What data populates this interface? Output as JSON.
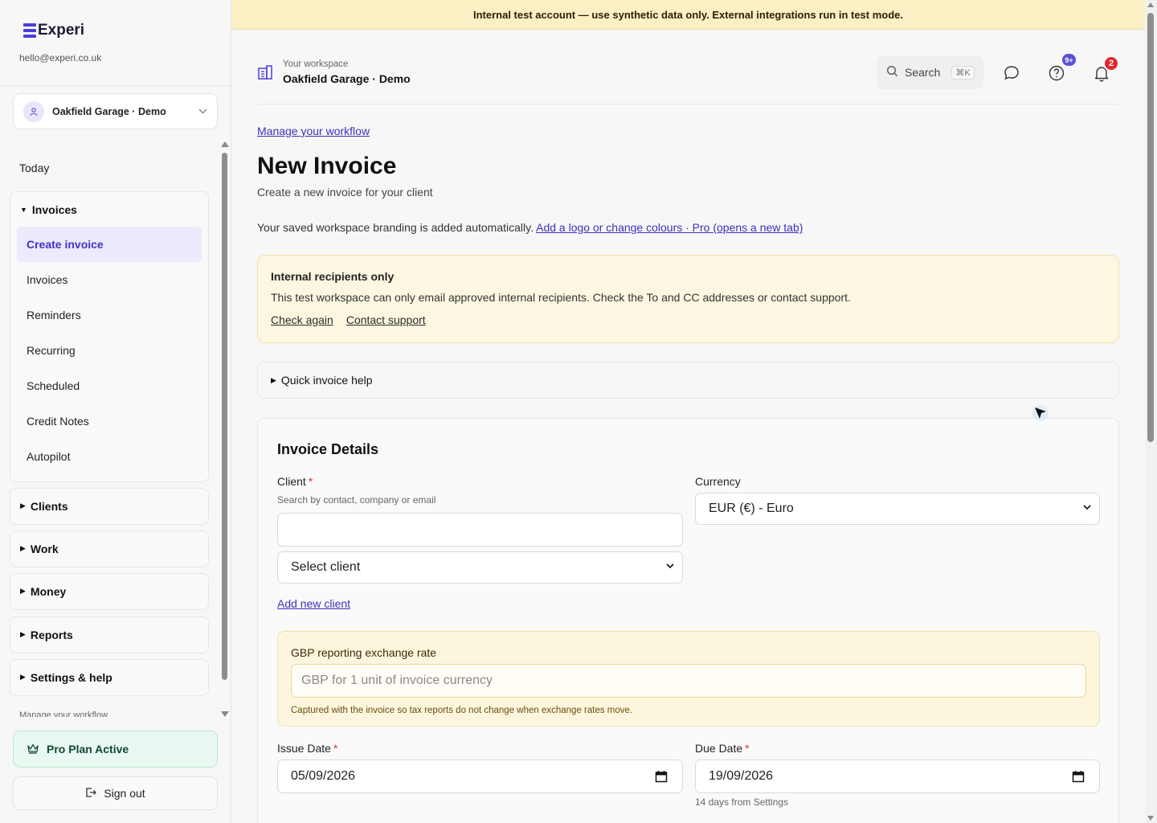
{
  "brand": {
    "name": "Experi",
    "email": "hello@experi.co.uk",
    "accent": "#4b3fd9"
  },
  "workspace_selector": {
    "name": "Oakfield Garage · Demo"
  },
  "sidebar": {
    "today": "Today",
    "groups": [
      {
        "label": "Invoices",
        "expanded": true,
        "items": [
          "Create invoice",
          "Invoices",
          "Reminders",
          "Recurring",
          "Scheduled",
          "Credit Notes",
          "Autopilot"
        ],
        "active": "Create invoice"
      },
      {
        "label": "Clients",
        "expanded": false
      },
      {
        "label": "Work",
        "expanded": false
      },
      {
        "label": "Money",
        "expanded": false
      },
      {
        "label": "Reports",
        "expanded": false
      },
      {
        "label": "Settings & help",
        "expanded": false
      }
    ],
    "peek": "Manage your workflow",
    "pro_plan": "Pro Plan Active",
    "sign_out": "Sign out"
  },
  "banner": "Internal test account — use synthetic data only. External integrations run in test mode.",
  "topbar": {
    "caption": "Your workspace",
    "title": "Oakfield Garage · Demo",
    "search_label": "Search",
    "search_shortcut": "⌘K",
    "help_badge": "9+",
    "notification_badge": "2"
  },
  "page": {
    "workflow_link": "Manage your workflow",
    "title": "New Invoice",
    "subtitle": "Create a new invoice for your client",
    "branding_note": "Your saved workspace branding is added automatically.",
    "branding_link": "Add a logo or change colours · Pro (opens a new tab)"
  },
  "alert": {
    "title": "Internal recipients only",
    "text": "This test workspace can only email approved internal recipients. Check the To and CC addresses or contact support.",
    "check_again": "Check again",
    "contact_support": "Contact support"
  },
  "help": {
    "label": "Quick invoice help"
  },
  "form": {
    "title": "Invoice Details",
    "client_label": "Client",
    "client_hint": "Search by contact, company or email",
    "client_search_value": "",
    "client_select_value": "Select client",
    "add_client": "Add new client",
    "currency_label": "Currency",
    "currency_value": "EUR (€) - Euro",
    "rate_label": "GBP reporting exchange rate",
    "rate_placeholder": "GBP for 1 unit of invoice currency",
    "rate_hint": "Captured with the invoice so tax reports do not change when exchange rates move.",
    "issue_label": "Issue Date",
    "issue_value": "05/09/2026",
    "due_label": "Due Date",
    "due_value": "19/09/2026",
    "due_hint": "14 days from Settings",
    "required_mark": "*"
  }
}
